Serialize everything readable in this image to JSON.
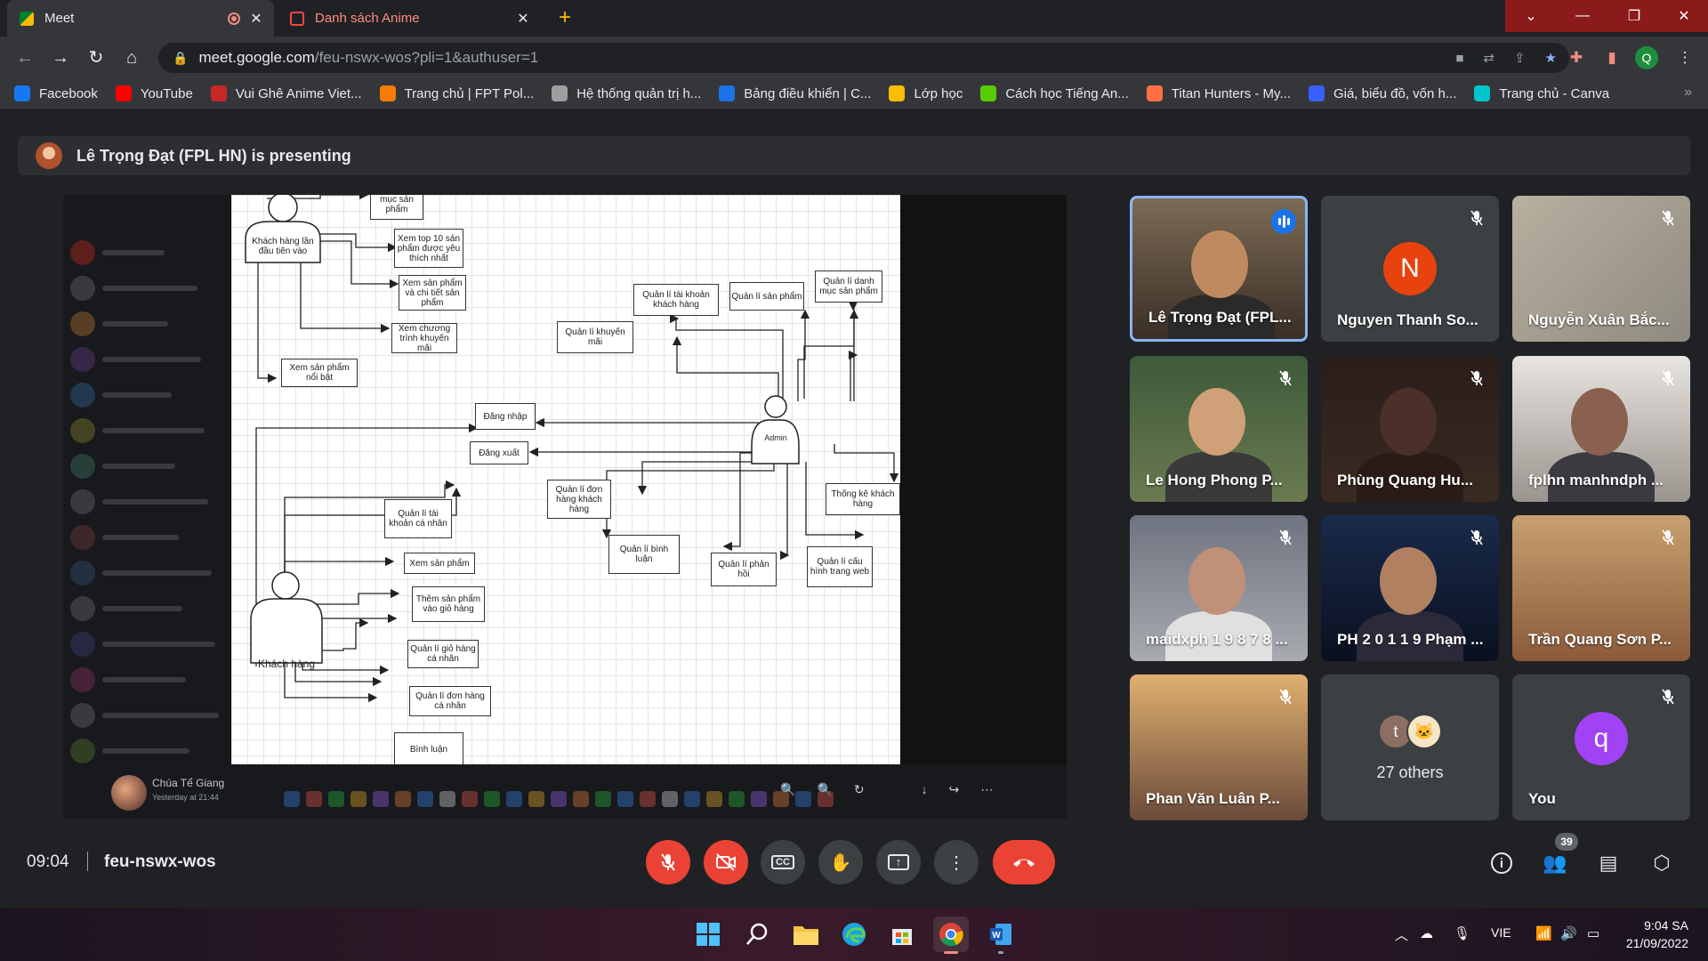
{
  "browser": {
    "tabs": [
      {
        "label": "Meet",
        "active": true
      },
      {
        "label": "Danh sách Anime",
        "active": false
      }
    ],
    "url_host": "meet.google.com",
    "url_path": "/feu-nswx-wos?pli=1&authuser=1",
    "profile_initial": "Q",
    "bookmarks": [
      {
        "label": "Facebook",
        "icon": "facebook-icon",
        "color": "#1877f2"
      },
      {
        "label": "YouTube",
        "icon": "youtube-icon",
        "color": "#ff0000"
      },
      {
        "label": "Vui Ghê Anime Viet...",
        "icon": "anime-site-icon",
        "color": "#c62828"
      },
      {
        "label": "Trang chủ | FPT Pol...",
        "icon": "fpt-icon",
        "color": "#f57c00"
      },
      {
        "label": "Hệ thống quản trị h...",
        "icon": "system-icon",
        "color": "#9e9e9e"
      },
      {
        "label": "Bảng điều khiển | C...",
        "icon": "dashboard-icon",
        "color": "#1a73e8"
      },
      {
        "label": "Lớp học",
        "icon": "classroom-icon",
        "color": "#fbbc04"
      },
      {
        "label": "Cách học Tiếng An...",
        "icon": "duolingo-icon",
        "color": "#58cc02"
      },
      {
        "label": "Titan Hunters - My...",
        "icon": "game-icon",
        "color": "#ff7043"
      },
      {
        "label": "Giá, biểu đồ, vốn h...",
        "icon": "coin-icon",
        "color": "#3861fb"
      },
      {
        "label": "Trang chủ - Canva",
        "icon": "canva-icon",
        "color": "#00c4cc"
      }
    ]
  },
  "meet": {
    "presenting_banner": "Lê Trọng Đạt (FPL HN) is presenting",
    "whiteboard": {
      "actors": [
        "Khách hàng lần đầu tiên vào",
        "Admin",
        "Khách hàng"
      ],
      "boxes": [
        "mục sản phẩm",
        "Xem top 10 sản phẩm được yêu thích nhất",
        "Xem sản phẩm và chi tiết sản phẩm",
        "Xem chương trình khuyến mãi",
        "Xem sản phẩm nổi bật",
        "Đăng nhập",
        "Đăng xuất",
        "Quản lí tài khoản khách hàng",
        "Quản lí sản phẩm",
        "Quản lí danh mục sản phẩm",
        "Quản lí khuyến mãi",
        "Quản lí đơn hàng khách hàng",
        "Quản lí bình luận",
        "Quản lí phản hồi",
        "Quản lí cấu hình trang web",
        "Thống kê khách hàng",
        "Quản lí tài khoản cá nhân",
        "Xem sản phẩm",
        "Thêm sản phẩm vào giỏ hàng",
        "Quản lí giỏ hàng cá nhân",
        "Quản lí đơn hàng cá nhân",
        "Bình luận"
      ],
      "footer_sender": "Chúa Tể Giang",
      "footer_time": "Yesterday at 21:44"
    },
    "participants": [
      {
        "name": "Lê Trọng Đạt (FPL...",
        "speaking": true,
        "muted": false
      },
      {
        "name": "Nguyen Thanh So...",
        "initial": "N",
        "initial_color": "#e8430f",
        "muted": true
      },
      {
        "name": "Nguyễn Xuân Bắc...",
        "muted": true
      },
      {
        "name": "Le Hong Phong P...",
        "muted": true
      },
      {
        "name": "Phùng Quang Hu...",
        "muted": true
      },
      {
        "name": "fplhn manhndph ...",
        "muted": true
      },
      {
        "name": "maidxph 1 9 8 7 8 ...",
        "muted": true
      },
      {
        "name": "PH 2 0 1 1 9 Phạm ...",
        "muted": true
      },
      {
        "name": "Trần Quang Sơn P...",
        "muted": true
      },
      {
        "name": "Phan Văn Luân P...",
        "muted": true
      },
      {
        "name": "27 others",
        "others_avatars": [
          "t",
          "cat"
        ]
      },
      {
        "name": "You",
        "initial": "q",
        "initial_color": "#a142f4",
        "muted": true
      }
    ],
    "time": "09:04",
    "meeting_code": "feu-nswx-wos",
    "people_count": "39"
  },
  "taskbar": {
    "language": "VIE",
    "clock_time": "9:04 SA",
    "clock_date": "21/09/2022"
  },
  "colors": {
    "meet_bg": "#202124",
    "end_call": "#ea4335",
    "speaking_border": "#8ab4f8"
  }
}
